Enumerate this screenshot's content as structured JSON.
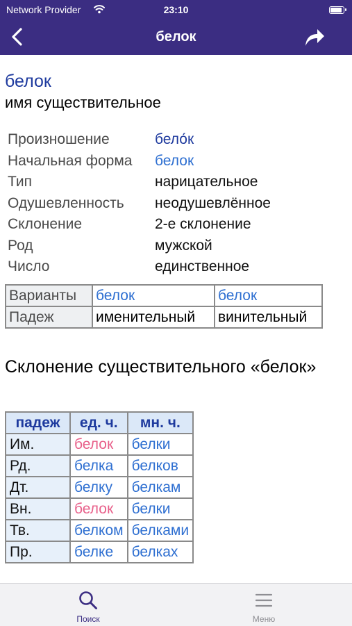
{
  "status_bar": {
    "carrier": "Network Provider",
    "time": "23:10",
    "battery_level": 0.9
  },
  "nav": {
    "title": "белок",
    "back_icon": "chevron-left-icon",
    "share_icon": "share-arrow-icon"
  },
  "entry": {
    "word": "белок",
    "part_of_speech": "имя существительное",
    "properties": [
      {
        "label": "Произношение",
        "value": "бело́к"
      },
      {
        "label": "Начальная форма",
        "value": "белок"
      },
      {
        "label": "Тип",
        "value": "нарицательное"
      },
      {
        "label": "Одушевленность",
        "value": "неодушевлённое"
      },
      {
        "label": "Склонение",
        "value": "2-е склонение"
      },
      {
        "label": "Род",
        "value": "мужской"
      },
      {
        "label": "Число",
        "value": "единственное"
      }
    ]
  },
  "variants": {
    "row1_label": "Варианты",
    "row1_values": [
      "белок",
      "белок"
    ],
    "row2_label": "Падеж",
    "row2_values": [
      "именительный",
      "винительный"
    ]
  },
  "declension": {
    "title": "Склонение существительного «белок»",
    "headers": [
      "падеж",
      "ед. ч.",
      "мн. ч."
    ],
    "rows": [
      {
        "case": "Им.",
        "singular": "белок",
        "plural": "белки"
      },
      {
        "case": "Рд.",
        "singular": "белка",
        "plural": "белков"
      },
      {
        "case": "Дт.",
        "singular": "белку",
        "plural": "белкам"
      },
      {
        "case": "Вн.",
        "singular": "белок",
        "plural": "белки"
      },
      {
        "case": "Тв.",
        "singular": "белком",
        "plural": "белками"
      },
      {
        "case": "Пр.",
        "singular": "белке",
        "plural": "белках"
      }
    ]
  },
  "tabbar": {
    "search_label": "Поиск",
    "menu_label": "Меню",
    "search_icon": "search-icon",
    "menu_icon": "menu-icon"
  },
  "colors": {
    "primary": "#3b2d82",
    "link": "#2e6fd1",
    "highlight": "#e8608a",
    "dark_blue": "#1e3a9e"
  }
}
